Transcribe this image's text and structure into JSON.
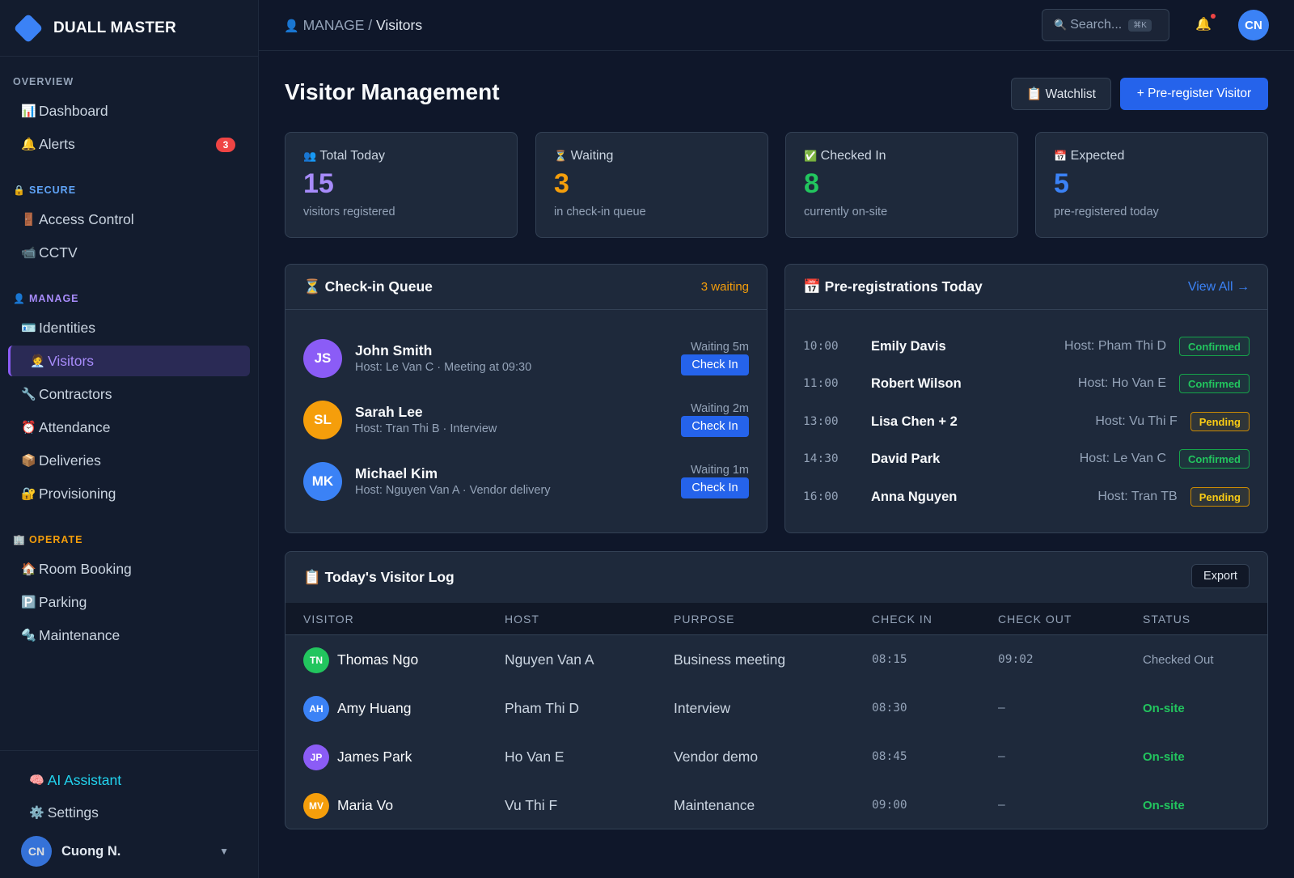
{
  "brand": {
    "name": "DUALL MASTER"
  },
  "sidebar": {
    "groups": [
      {
        "title": "OVERVIEW",
        "icon": "",
        "color": "#94a3b8",
        "items": [
          {
            "icon": "📊",
            "label": "Dashboard"
          },
          {
            "icon": "🔔",
            "label": "Alerts",
            "badge": "3"
          }
        ]
      },
      {
        "title": "SECURE",
        "icon": "🔒",
        "color": "#60a5fa",
        "items": [
          {
            "icon": "🚪",
            "label": "Access Control"
          },
          {
            "icon": "📹",
            "label": "CCTV"
          }
        ]
      },
      {
        "title": "MANAGE",
        "icon": "👤",
        "color": "#a78bfa",
        "items": [
          {
            "icon": "🪪",
            "label": "Identities"
          },
          {
            "icon": "🧑‍💼",
            "label": "Visitors",
            "active": true
          },
          {
            "icon": "🔧",
            "label": "Contractors"
          },
          {
            "icon": "⏰",
            "label": "Attendance"
          },
          {
            "icon": "📦",
            "label": "Deliveries"
          },
          {
            "icon": "🔐",
            "label": "Provisioning"
          }
        ]
      },
      {
        "title": "OPERATE",
        "icon": "🏢",
        "color": "#f59e0b",
        "items": [
          {
            "icon": "🏠",
            "label": "Room Booking"
          },
          {
            "icon": "🅿️",
            "label": "Parking"
          },
          {
            "icon": "🔩",
            "label": "Maintenance"
          }
        ]
      }
    ],
    "bottom": {
      "ai_icon": "🧠",
      "ai_label": "AI Assistant",
      "settings_icon": "⚙️",
      "settings_label": "Settings",
      "user_initials": "CN",
      "user_name": "Cuong N."
    }
  },
  "topbar": {
    "crumb_icon": "👤",
    "crumb_parent": "MANAGE",
    "crumb_sep": "/",
    "crumb_current": "Visitors",
    "search_placeholder": "Search...",
    "search_shortcut": "⌘K",
    "avatar_initials": "CN"
  },
  "page": {
    "title": "Visitor Management",
    "watchlist_label": "📋 Watchlist",
    "preregister_label": "+ Pre-register Visitor"
  },
  "stats": [
    {
      "icon": "👥",
      "label": "Total Today",
      "value": "15",
      "sub": "visitors registered",
      "color": "#a78bfa"
    },
    {
      "icon": "⏳",
      "label": "Waiting",
      "value": "3",
      "sub": "in check-in queue",
      "color": "#f59e0b"
    },
    {
      "icon": "✅",
      "label": "Checked In",
      "value": "8",
      "sub": "currently on-site",
      "color": "#22c55e"
    },
    {
      "icon": "📅",
      "label": "Expected",
      "value": "5",
      "sub": "pre-registered today",
      "color": "#3b82f6"
    }
  ],
  "queue": {
    "title": "⏳ Check-in Queue",
    "count_label": "3 waiting",
    "check_in_label": "Check In",
    "items": [
      {
        "initials": "JS",
        "name": "John Smith",
        "sub": "Host: Le Van C · Meeting at 09:30",
        "wait": "Waiting 5m",
        "color": "#8b5cf6"
      },
      {
        "initials": "SL",
        "name": "Sarah Lee",
        "sub": "Host: Tran Thi B · Interview",
        "wait": "Waiting 2m",
        "color": "#f59e0b"
      },
      {
        "initials": "MK",
        "name": "Michael Kim",
        "sub": "Host: Nguyen Van A · Vendor delivery",
        "wait": "Waiting 1m",
        "color": "#3b82f6"
      }
    ]
  },
  "prereg": {
    "title": "📅 Pre-registrations Today",
    "view_all": "View All →",
    "items": [
      {
        "time": "10:00",
        "name": "Emily Davis",
        "host": "Host: Pham Thi D",
        "status": "Confirmed"
      },
      {
        "time": "11:00",
        "name": "Robert Wilson",
        "host": "Host: Ho Van E",
        "status": "Confirmed"
      },
      {
        "time": "13:00",
        "name": "Lisa Chen + 2",
        "host": "Host: Vu Thi F",
        "status": "Pending"
      },
      {
        "time": "14:30",
        "name": "David Park",
        "host": "Host: Le Van C",
        "status": "Confirmed"
      },
      {
        "time": "16:00",
        "name": "Anna Nguyen",
        "host": "Host: Tran TB",
        "status": "Pending"
      }
    ]
  },
  "log": {
    "title": "📋 Today's Visitor Log",
    "export_label": "Export",
    "columns": [
      "VISITOR",
      "HOST",
      "PURPOSE",
      "CHECK IN",
      "CHECK OUT",
      "STATUS"
    ],
    "rows": [
      {
        "initials": "TN",
        "name": "Thomas Ngo",
        "host": "Nguyen Van A",
        "purpose": "Business meeting",
        "check_in": "08:15",
        "check_out": "09:02",
        "status": "Checked Out",
        "color": "#22c55e"
      },
      {
        "initials": "AH",
        "name": "Amy Huang",
        "host": "Pham Thi D",
        "purpose": "Interview",
        "check_in": "08:30",
        "check_out": "—",
        "status": "On-site",
        "color": "#3b82f6"
      },
      {
        "initials": "JP",
        "name": "James Park",
        "host": "Ho Van E",
        "purpose": "Vendor demo",
        "check_in": "08:45",
        "check_out": "—",
        "status": "On-site",
        "color": "#8b5cf6"
      },
      {
        "initials": "MV",
        "name": "Maria Vo",
        "host": "Vu Thi F",
        "purpose": "Maintenance",
        "check_in": "09:00",
        "check_out": "—",
        "status": "On-site",
        "color": "#f59e0b"
      }
    ]
  }
}
